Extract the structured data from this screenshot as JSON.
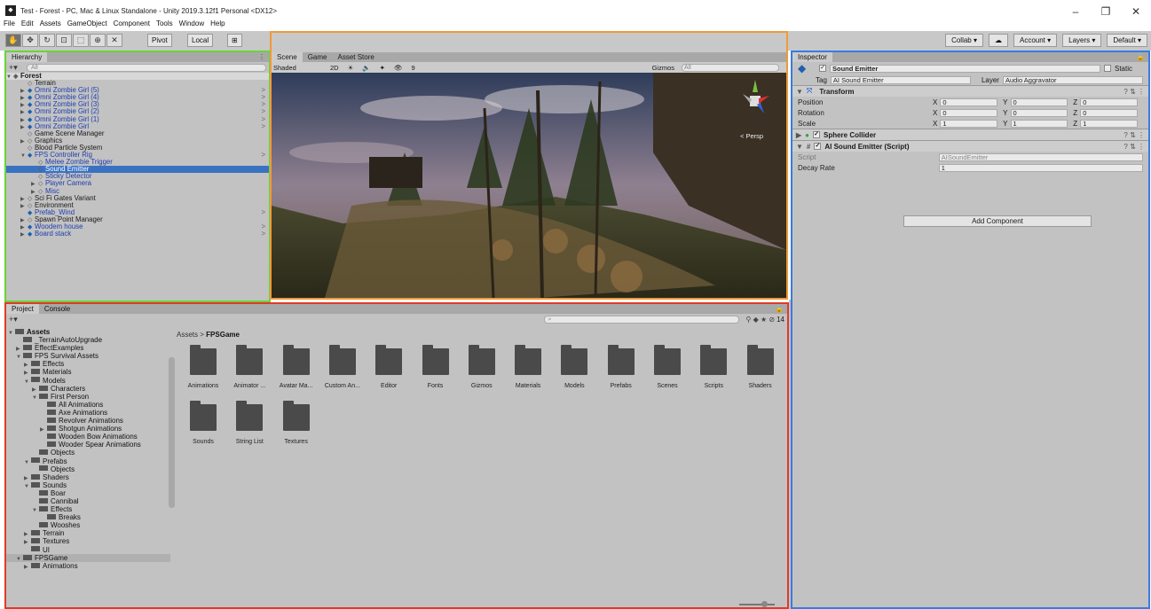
{
  "window": {
    "title": "Test - Forest - PC, Mac & Linux Standalone - Unity 2019.3.12f1 Personal <DX12>",
    "controls": [
      "–",
      "❐",
      "✕"
    ]
  },
  "menu": [
    "File",
    "Edit",
    "Assets",
    "GameObject",
    "Component",
    "Tools",
    "Window",
    "Help"
  ],
  "toolbar": {
    "pivot_label": "Pivot",
    "local_label": "Local",
    "collab_label": "Collab ▾",
    "account_label": "Account ▾",
    "layers_label": "Layers ▾",
    "layout_label": "Default ▾"
  },
  "hierarchy": {
    "tab_label": "Hierarchy",
    "search_placeholder": "All",
    "scene_name": "Forest",
    "items": [
      {
        "label": "Terrain",
        "depth": 1,
        "blue": false,
        "arrow": false,
        "prefab": false
      },
      {
        "label": "Omni Zombie Girl (5)",
        "depth": 1,
        "blue": true,
        "arrow": true,
        "prefab": true,
        "chev": true
      },
      {
        "label": "Omni Zombie Girl (4)",
        "depth": 1,
        "blue": true,
        "arrow": true,
        "prefab": true,
        "chev": true
      },
      {
        "label": "Omni Zombie Girl (3)",
        "depth": 1,
        "blue": true,
        "arrow": true,
        "prefab": true,
        "chev": true
      },
      {
        "label": "Omni Zombie Girl (2)",
        "depth": 1,
        "blue": true,
        "arrow": true,
        "prefab": true,
        "chev": true
      },
      {
        "label": "Omni Zombie Girl (1)",
        "depth": 1,
        "blue": true,
        "arrow": true,
        "prefab": true,
        "chev": true
      },
      {
        "label": "Omni Zombie Girl",
        "depth": 1,
        "blue": true,
        "arrow": true,
        "prefab": true,
        "chev": true
      },
      {
        "label": "Game Scene Manager",
        "depth": 1,
        "blue": false,
        "arrow": false,
        "prefab": false
      },
      {
        "label": "Graphics",
        "depth": 1,
        "blue": false,
        "arrow": true,
        "prefab": false
      },
      {
        "label": "Blood Particle System",
        "depth": 1,
        "blue": false,
        "arrow": false,
        "prefab": false
      },
      {
        "label": "FPS Controller Rig",
        "depth": 1,
        "blue": true,
        "arrow": true,
        "open": true,
        "prefab": true,
        "chev": true
      },
      {
        "label": "Melee Zombie Trigger",
        "depth": 2,
        "blue": true,
        "arrow": false,
        "prefab": false
      },
      {
        "label": "Sound Emitter",
        "depth": 2,
        "blue": false,
        "arrow": false,
        "prefab": false,
        "selected": true
      },
      {
        "label": "Sticky Detector",
        "depth": 2,
        "blue": true,
        "arrow": false,
        "prefab": false
      },
      {
        "label": "Player Camera",
        "depth": 2,
        "blue": true,
        "arrow": true,
        "prefab": false
      },
      {
        "label": "Misc",
        "depth": 2,
        "blue": true,
        "arrow": true,
        "prefab": false
      },
      {
        "label": "Sci Fi Gates Variant",
        "depth": 1,
        "blue": false,
        "arrow": true,
        "prefab": false
      },
      {
        "label": "Environment",
        "depth": 1,
        "blue": false,
        "arrow": true,
        "prefab": false
      },
      {
        "label": "Prefab_Wind",
        "depth": 1,
        "blue": true,
        "arrow": false,
        "prefab": true,
        "chev": true
      },
      {
        "label": "Spawn Point Manager",
        "depth": 1,
        "blue": false,
        "arrow": true,
        "prefab": false
      },
      {
        "label": "Woodem house",
        "depth": 1,
        "blue": true,
        "arrow": true,
        "prefab": true,
        "chev": true
      },
      {
        "label": "Board stack",
        "depth": 1,
        "blue": true,
        "arrow": true,
        "prefab": true,
        "chev": true
      }
    ]
  },
  "scene": {
    "tabs": [
      "Scene",
      "Game",
      "Asset Store"
    ],
    "shading": "Shaded",
    "mode_2d": "2D",
    "gizmos": "Gizmos",
    "search_placeholder": "All",
    "layer_count": "9",
    "persp_label": "< Persp"
  },
  "inspector": {
    "tab_label": "Inspector",
    "object_name": "Sound Emitter",
    "static_label": "Static",
    "tag_label": "Tag",
    "tag_value": "AI Sound Emitter",
    "layer_label": "Layer",
    "layer_value": "Audio Aggravator",
    "transform": {
      "title": "Transform",
      "rows": [
        {
          "label": "Position",
          "x": "0",
          "y": "0",
          "z": "0"
        },
        {
          "label": "Rotation",
          "x": "0",
          "y": "0",
          "z": "0"
        },
        {
          "label": "Scale",
          "x": "1",
          "y": "1",
          "z": "1"
        }
      ]
    },
    "sphere_collider": "Sphere Collider",
    "script_component": "AI Sound Emitter (Script)",
    "script_label": "Script",
    "script_value": "AISoundEmitter",
    "decay_label": "Decay Rate",
    "decay_value": "1",
    "add_component": "Add Component"
  },
  "project": {
    "tabs": [
      "Project",
      "Console"
    ],
    "badge": "14",
    "breadcrumb_root": "Assets",
    "breadcrumb_sep": ">",
    "breadcrumb_current": "FPSGame",
    "tree": [
      {
        "label": "Assets",
        "depth": 0,
        "arrow": "open",
        "bold": true
      },
      {
        "label": "_TerrainAutoUpgrade",
        "depth": 1,
        "arrow": ""
      },
      {
        "label": "EffectExamples",
        "depth": 1,
        "arrow": "closed"
      },
      {
        "label": "FPS Survival Assets",
        "depth": 1,
        "arrow": "open"
      },
      {
        "label": "Effects",
        "depth": 2,
        "arrow": "closed"
      },
      {
        "label": "Materials",
        "depth": 2,
        "arrow": "closed"
      },
      {
        "label": "Models",
        "depth": 2,
        "arrow": "open"
      },
      {
        "label": "Characters",
        "depth": 3,
        "arrow": "closed"
      },
      {
        "label": "First Person",
        "depth": 3,
        "arrow": "open"
      },
      {
        "label": "All Animations",
        "depth": 4,
        "arrow": ""
      },
      {
        "label": "Axe Animations",
        "depth": 4,
        "arrow": ""
      },
      {
        "label": "Revolver Animations",
        "depth": 4,
        "arrow": ""
      },
      {
        "label": "Shotgun Animations",
        "depth": 4,
        "arrow": "closed"
      },
      {
        "label": "Wooden Bow Animations",
        "depth": 4,
        "arrow": ""
      },
      {
        "label": "Wooder Spear Animations",
        "depth": 4,
        "arrow": ""
      },
      {
        "label": "Objects",
        "depth": 3,
        "arrow": ""
      },
      {
        "label": "Prefabs",
        "depth": 2,
        "arrow": "open"
      },
      {
        "label": "Objects",
        "depth": 3,
        "arrow": ""
      },
      {
        "label": "Shaders",
        "depth": 2,
        "arrow": "closed"
      },
      {
        "label": "Sounds",
        "depth": 2,
        "arrow": "open"
      },
      {
        "label": "Boar",
        "depth": 3,
        "arrow": ""
      },
      {
        "label": "Cannibal",
        "depth": 3,
        "arrow": ""
      },
      {
        "label": "Effects",
        "depth": 3,
        "arrow": "open"
      },
      {
        "label": "Breaks",
        "depth": 4,
        "arrow": ""
      },
      {
        "label": "Wooshes",
        "depth": 3,
        "arrow": ""
      },
      {
        "label": "Terrain",
        "depth": 2,
        "arrow": "closed"
      },
      {
        "label": "Textures",
        "depth": 2,
        "arrow": "closed"
      },
      {
        "label": "UI",
        "depth": 2,
        "arrow": ""
      },
      {
        "label": "FPSGame",
        "depth": 1,
        "arrow": "open",
        "selected": true
      },
      {
        "label": "Animations",
        "depth": 2,
        "arrow": "closed"
      }
    ],
    "folders": [
      "Animations",
      "Animator ...",
      "Avatar Ma...",
      "Custom An...",
      "Editor",
      "Fonts",
      "Gizmos",
      "Materials",
      "Models",
      "Prefabs",
      "Scenes",
      "Scripts",
      "Shaders",
      "Sounds",
      "String List",
      "Textures"
    ]
  }
}
